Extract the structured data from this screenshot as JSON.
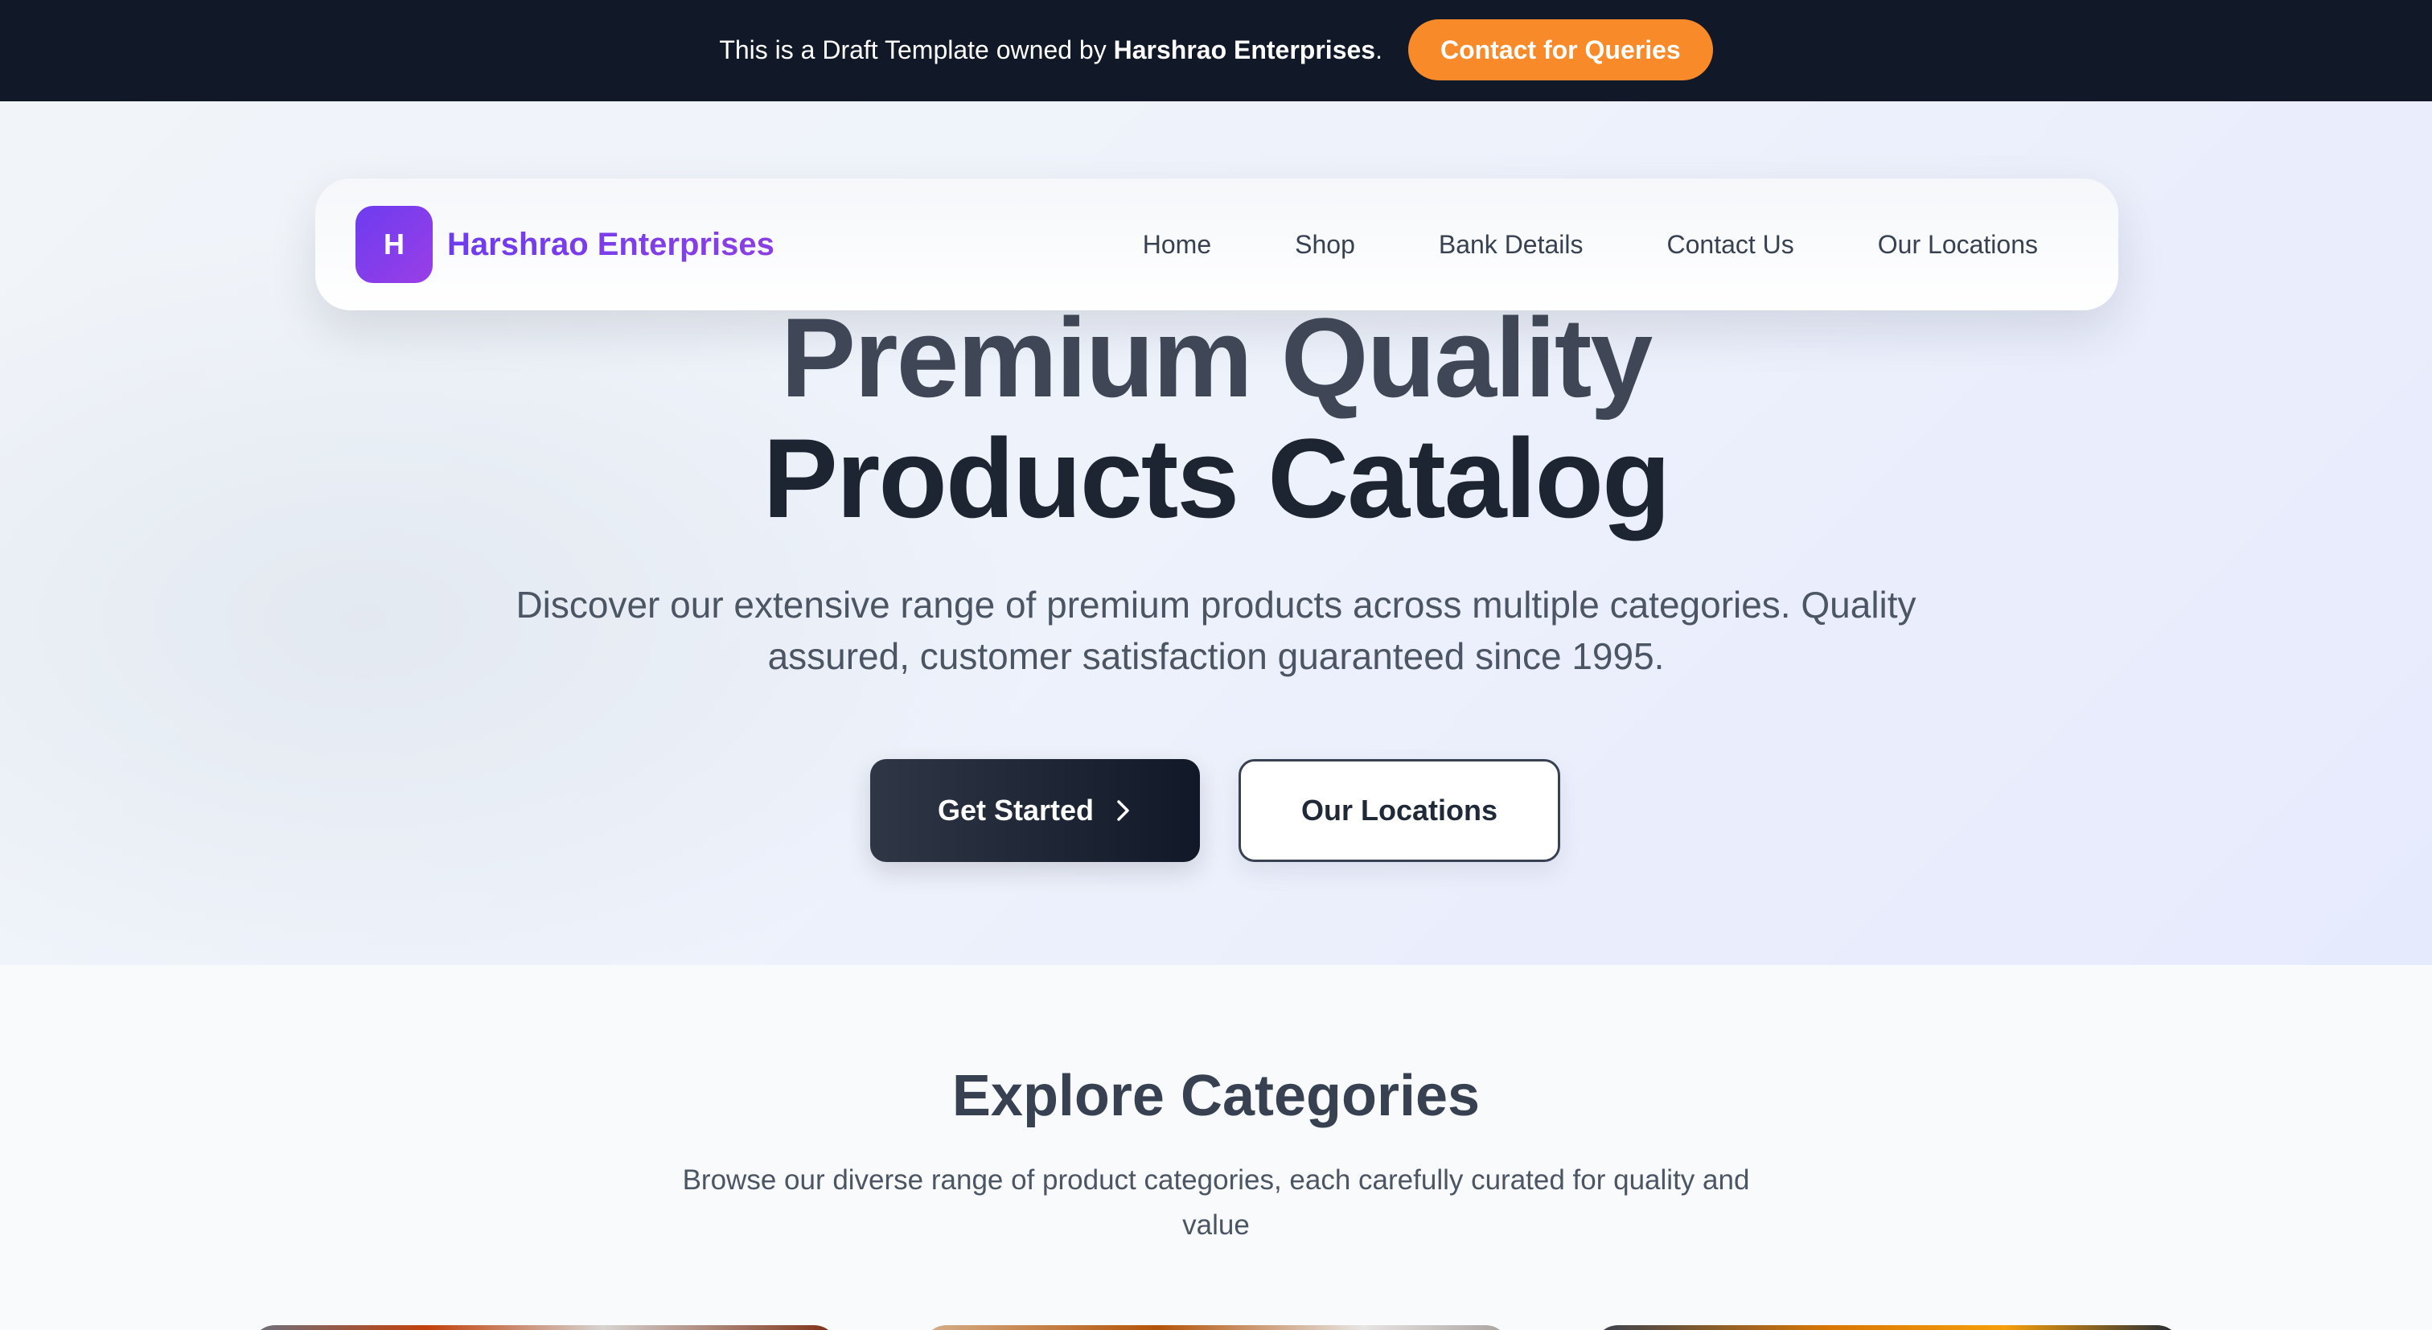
{
  "banner": {
    "text_prefix": "This is a Draft Template owned by ",
    "owner": "Harshrao Enterprises",
    "text_suffix": ".",
    "cta_label": "Contact for Queries",
    "cta_color": "#f98a2a"
  },
  "navbar": {
    "logo_letter": "H",
    "brand": "Harshrao Enterprises",
    "brand_color": "#6d3cf0",
    "links": [
      {
        "label": "Home"
      },
      {
        "label": "Shop"
      },
      {
        "label": "Bank Details"
      },
      {
        "label": "Contact Us"
      },
      {
        "label": "Our Locations"
      }
    ]
  },
  "hero": {
    "title_line1": "Premium Quality",
    "title_line2": "Products Catalog",
    "subtitle": "Discover our extensive range of premium products across multiple categories. Quality assured, customer satisfaction guaranteed since 1995.",
    "primary_button": "Get Started",
    "primary_button_icon": "chevron-right-icon",
    "secondary_button": "Our Locations"
  },
  "categories": {
    "title": "Explore Categories",
    "subtitle": "Browse our diverse range of product categories, each carefully curated for quality and value"
  }
}
